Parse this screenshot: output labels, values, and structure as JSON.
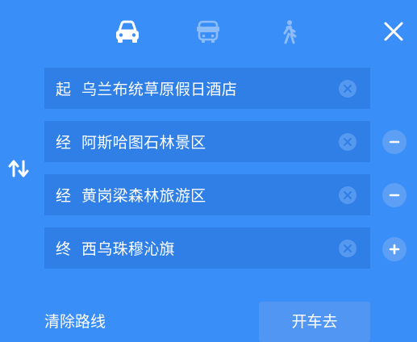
{
  "modes": [
    {
      "name": "car",
      "icon": "car-icon",
      "active": true
    },
    {
      "name": "bus",
      "icon": "bus-icon",
      "active": false
    },
    {
      "name": "walk",
      "icon": "walk-icon",
      "active": false
    }
  ],
  "fields": [
    {
      "prefix": "起",
      "value": "乌兰布统草原假日酒店",
      "action": null
    },
    {
      "prefix": "经",
      "value": "阿斯哈图石林景区",
      "action": "remove"
    },
    {
      "prefix": "经",
      "value": "黄岗梁森林旅游区",
      "action": "remove"
    },
    {
      "prefix": "终",
      "value": "西乌珠穆沁旗",
      "action": "add"
    }
  ],
  "footer": {
    "clear_label": "清除路线",
    "go_label": "开车去"
  },
  "colors": {
    "background": "#3a8ef8",
    "field_bg": "#2f7fe6",
    "inactive_icon": "#8cbdfa"
  }
}
